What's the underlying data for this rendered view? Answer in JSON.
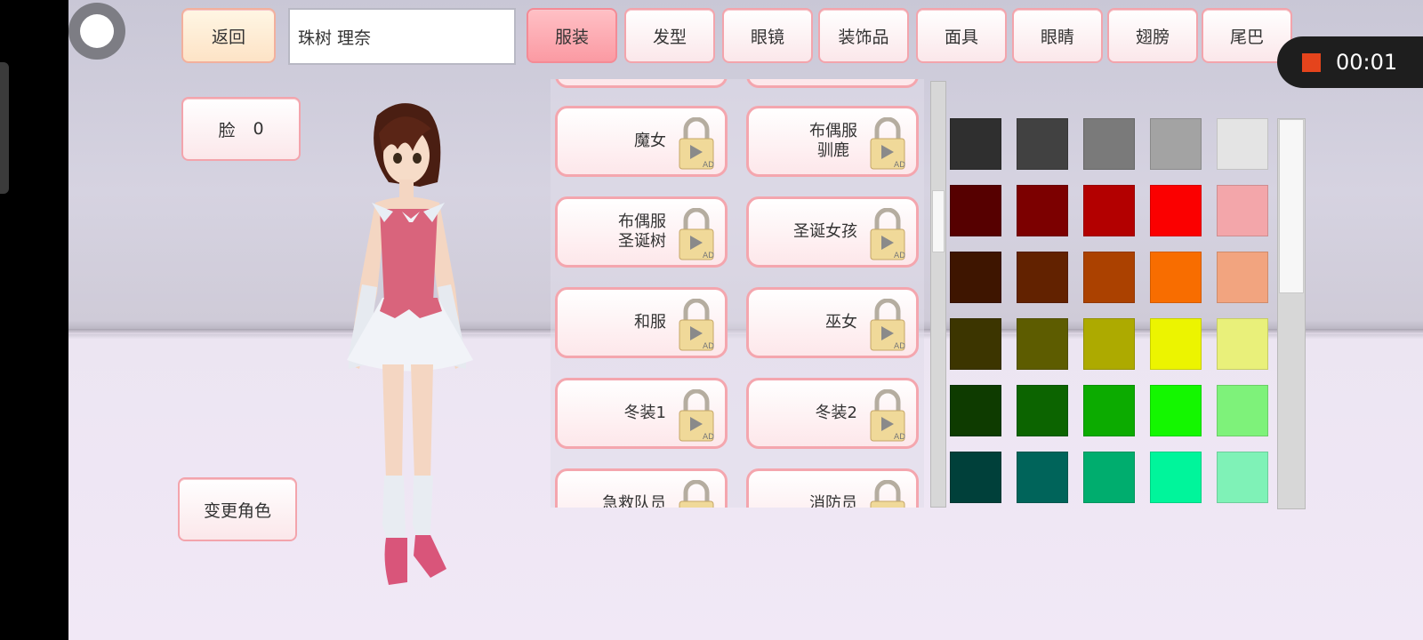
{
  "top_bar": {
    "back_label": "返回",
    "name_value": "珠树 理奈",
    "tabs": [
      {
        "label": "服装",
        "active": true
      },
      {
        "label": "发型",
        "active": false
      },
      {
        "label": "眼镜",
        "active": false
      },
      {
        "label": "装饰品",
        "active": false
      },
      {
        "label": "面具",
        "active": false
      },
      {
        "label": "眼睛",
        "active": false
      },
      {
        "label": "翅膀",
        "active": false
      },
      {
        "label": "尾巴",
        "active": false
      }
    ]
  },
  "left_panel": {
    "face_label": "脸",
    "face_value": "0",
    "change_character_label": "变更角色"
  },
  "recorder": {
    "time": "00:01"
  },
  "costume_list": {
    "items": [
      {
        "label": "魔女",
        "locked": true,
        "ad_badge": "AD"
      },
      {
        "label": "布偶服\n驯鹿",
        "locked": true,
        "ad_badge": "AD"
      },
      {
        "label": "布偶服\n圣诞树",
        "locked": true,
        "ad_badge": "AD"
      },
      {
        "label": "圣诞女孩",
        "locked": true,
        "ad_badge": "AD"
      },
      {
        "label": "和服",
        "locked": true,
        "ad_badge": "AD"
      },
      {
        "label": "巫女",
        "locked": true,
        "ad_badge": "AD"
      },
      {
        "label": "冬装1",
        "locked": true,
        "ad_badge": "AD"
      },
      {
        "label": "冬装2",
        "locked": true,
        "ad_badge": "AD"
      },
      {
        "label": "急救队员",
        "locked": true,
        "ad_badge": "AD"
      },
      {
        "label": "消防员",
        "locked": true,
        "ad_badge": "AD"
      }
    ],
    "scroll_position": 0.3
  },
  "color_palette": {
    "rows": [
      [
        "#2f2f2f",
        "#414141",
        "#7a7a7a",
        "#a3a3a3",
        "#e4e4e4"
      ],
      [
        "#560000",
        "#7c0000",
        "#b30000",
        "#fb0000",
        "#f3a6aa"
      ],
      [
        "#3e1500",
        "#622200",
        "#ab4100",
        "#f86d00",
        "#f2a47f"
      ],
      [
        "#3c3500",
        "#5d5c00",
        "#adaa00",
        "#ecf400",
        "#e9f07a"
      ],
      [
        "#0e3b00",
        "#0c6400",
        "#0cab00",
        "#14f700",
        "#7ef27a"
      ],
      [
        "#00403a",
        "#00645a",
        "#00ad6e",
        "#00f59b",
        "#7ff2b7"
      ]
    ],
    "scroll_position": 0
  },
  "colors": {
    "button_border": "#f4a6ae",
    "active_tab": "#fb9aa3",
    "recorder_dot": "#e5441c"
  }
}
